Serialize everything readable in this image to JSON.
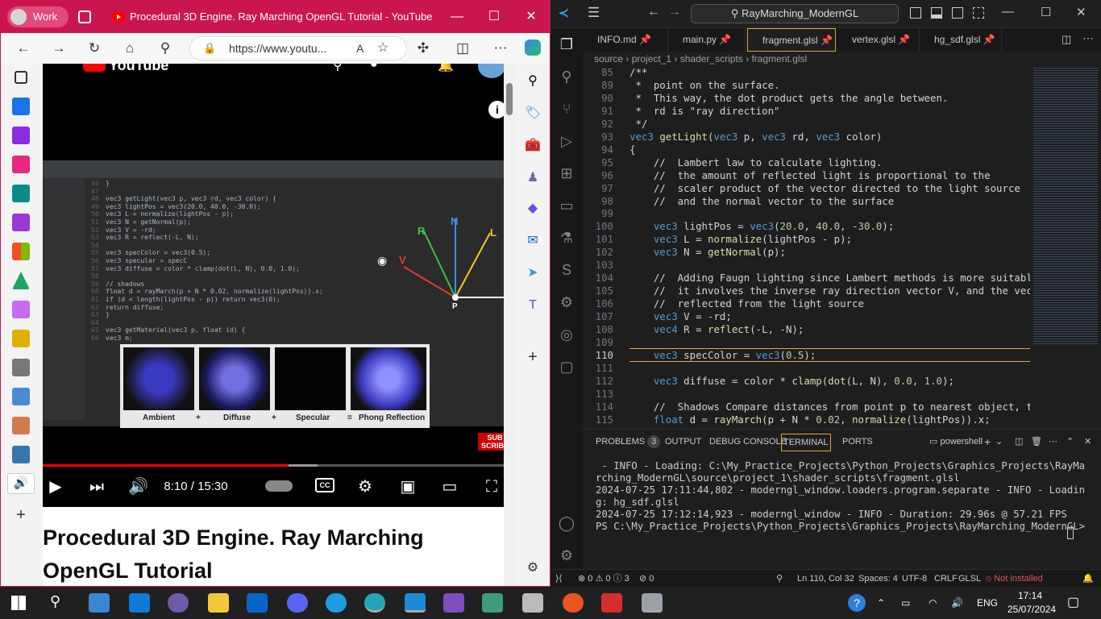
{
  "edge": {
    "profile": "Work",
    "tab_title": "Procedural 3D Engine. Ray Marching OpenGL Tutorial - YouTube",
    "address": "https://www.youtu...",
    "read_aloud": "A",
    "minimize": "—",
    "maximize": "☐",
    "close": "✕"
  },
  "youtube": {
    "logo": "YouTube",
    "time": "8:10 / 15:30",
    "progress_fraction": 0.52,
    "video_title": "Procedural 3D Engine. Ray Marching OpenGL Tutorial",
    "subscribe": "SUB SCRIBE",
    "cc": "CC",
    "phong_labels": [
      "Ambient",
      "+",
      "Diffuse",
      "+",
      "Specular",
      "=",
      "Phong Reflection"
    ],
    "vector_labels": [
      "R",
      "N",
      "L",
      "V",
      "P"
    ],
    "video_code": [
      {
        "n": "46",
        "t": "}"
      },
      {
        "n": "47",
        "t": ""
      },
      {
        "n": "48",
        "t": "vec3 getLight(vec3 p, vec3 rd, vec3 color) {"
      },
      {
        "n": "49",
        "t": "    vec3 lightPos = vec3(20.0, 40.0, -30.0);"
      },
      {
        "n": "50",
        "t": "    vec3 L = normalize(lightPos - p);"
      },
      {
        "n": "51",
        "t": "    vec3 N = getNormal(p);"
      },
      {
        "n": "52",
        "t": "    vec3 V = -rd;"
      },
      {
        "n": "53",
        "t": "    vec3 R = reflect(-L, N);"
      },
      {
        "n": "54",
        "t": ""
      },
      {
        "n": "55",
        "t": "    vec3 specColor = vec3(0.5);"
      },
      {
        "n": "56",
        "t": "    vec3 specular = specC"
      },
      {
        "n": "57",
        "t": "    vec3 diffuse = color * clamp(dot(L, N), 0.0, 1.0);"
      },
      {
        "n": "58",
        "t": ""
      },
      {
        "n": "59",
        "t": "    // shadows"
      },
      {
        "n": "60",
        "t": "    float d = rayMarch(p + N * 0.02, normalize(lightPos)).x;"
      },
      {
        "n": "61",
        "t": "    if (d < length(lightPos - p)) return vec3(0);"
      },
      {
        "n": "62",
        "t": "    return diffuse;"
      },
      {
        "n": "63",
        "t": "}"
      },
      {
        "n": "64",
        "t": ""
      },
      {
        "n": "65",
        "t": "vec3 getMaterial(vec3 p, float id) {"
      },
      {
        "n": "66",
        "t": "    vec3 m;"
      }
    ]
  },
  "vscode": {
    "search": "RayMarching_ModernGL",
    "tabs": [
      "INFO.md",
      "main.py",
      "fragment.glsl",
      "vertex.glsl",
      "hg_sdf.glsl"
    ],
    "breadcrumb": [
      "source",
      "project_1",
      "shader_scripts",
      "fragment.glsl"
    ],
    "code": [
      {
        "n": "85",
        "t": "/**"
      },
      {
        "n": "89",
        "t": " *  point on the surface."
      },
      {
        "n": "90",
        "t": " *  This way, the dot product gets the angle between."
      },
      {
        "n": "91",
        "t": " *  rd is \"ray direction\""
      },
      {
        "n": "92",
        "t": " */"
      },
      {
        "n": "93",
        "t": "vec3 getLight(vec3 p, vec3 rd, vec3 color)"
      },
      {
        "n": "94",
        "t": "{"
      },
      {
        "n": "95",
        "t": "    //  Lambert law to calculate lighting."
      },
      {
        "n": "96",
        "t": "    //  the amount of reflected light is proportional to the"
      },
      {
        "n": "97",
        "t": "    //  scaler product of the vector directed to the light source"
      },
      {
        "n": "98",
        "t": "    //  and the normal vector to the surface"
      },
      {
        "n": "99",
        "t": ""
      },
      {
        "n": "100",
        "t": "    vec3 lightPos = vec3(20.0, 40.0, -30.0);"
      },
      {
        "n": "101",
        "t": "    vec3 L = normalize(lightPos - p);"
      },
      {
        "n": "102",
        "t": "    vec3 N = getNormal(p);"
      },
      {
        "n": "103",
        "t": ""
      },
      {
        "n": "104",
        "t": "    //  Adding Faugn lighting since Lambert methods is more suitable f"
      },
      {
        "n": "105",
        "t": "    //  it involves the inverse ray direction vector V, and the vector"
      },
      {
        "n": "106",
        "t": "    //  reflected from the light source"
      },
      {
        "n": "107",
        "t": "    vec3 V = -rd;"
      },
      {
        "n": "108",
        "t": "    vec4 R = reflect(-L, -N);"
      },
      {
        "n": "109",
        "t": ""
      },
      {
        "n": "110",
        "t": "    vec3 specColor = vec3(0.5);"
      },
      {
        "n": "111",
        "t": ""
      },
      {
        "n": "112",
        "t": "    vec3 diffuse = color * clamp(dot(L, N), 0.0, 1.0);"
      },
      {
        "n": "113",
        "t": ""
      },
      {
        "n": "114",
        "t": "    //  Shadows Compare distances from point p to nearest object, the"
      },
      {
        "n": "115",
        "t": "    float d = rayMarch(p + N * 0.02, normalize(lightPos)).x;"
      }
    ],
    "panel_tabs": [
      "PROBLEMS",
      "OUTPUT",
      "DEBUG CONSOLE",
      "TERMINAL",
      "PORTS"
    ],
    "problems_count": "3",
    "shell": "powershell",
    "terminal": " - INFO - Loading: C:\\My_Practice_Projects\\Python_Projects\\Graphics_Projects\\RayMarching_ModernGL\\source\\project_1\\shader_scripts\\fragment.glsl\n2024-07-25 17:11:44,802 - moderngl_window.loaders.program.separate - INFO - Loading: hg_sdf.glsl\n2024-07-25 17:12:14,923 - moderngl_window - INFO - Duration: 29.96s @ 57.21 FPS\nPS C:\\My_Practice_Projects\\Python_Projects\\Graphics_Projects\\RayMarching_ModernGL> ",
    "status": {
      "errors": "0",
      "warnings": "0",
      "info": "3",
      "ports": "0",
      "position": "Ln 110, Col 32",
      "spaces": "Spaces: 4",
      "encoding": "UTF-8",
      "eol": "CRLF",
      "language": "GLSL",
      "lint": "Not installed"
    }
  },
  "taskbar": {
    "lang": "ENG",
    "time": "17:14",
    "date": "25/07/2024"
  },
  "colors": {
    "edge_title": "#c9164f",
    "vscode_accent": "#e8a23c",
    "yt_red": "#ff0000"
  }
}
